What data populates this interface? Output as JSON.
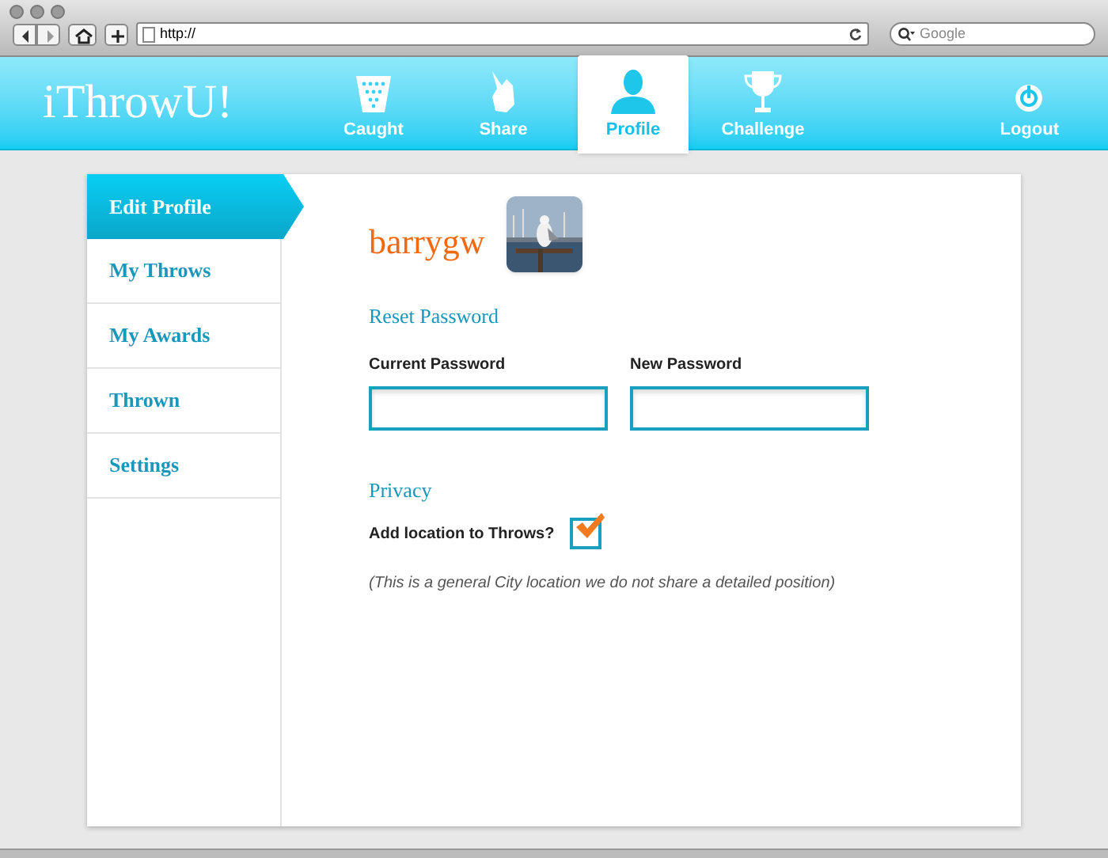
{
  "browser": {
    "address": "http://",
    "search_placeholder": "Google"
  },
  "app": {
    "logo": "iThrowU!"
  },
  "nav": [
    {
      "label": "Caught",
      "selected": false
    },
    {
      "label": "Share",
      "selected": false
    },
    {
      "label": "Profile",
      "selected": true
    },
    {
      "label": "Challenge",
      "selected": false
    }
  ],
  "logout": "Logout",
  "sidebar": {
    "items": [
      {
        "label": "Edit Profile",
        "selected": true
      },
      {
        "label": "My Throws",
        "selected": false
      },
      {
        "label": "My Awards",
        "selected": false
      },
      {
        "label": "Thrown",
        "selected": false
      },
      {
        "label": "Settings",
        "selected": false
      }
    ]
  },
  "profile": {
    "username": "barrygw"
  },
  "reset_password": {
    "heading": "Reset Password",
    "fields": [
      {
        "label": "Current Password"
      },
      {
        "label": "New Password"
      }
    ]
  },
  "privacy": {
    "heading": "Privacy",
    "option": {
      "label": "Add location to Throws?",
      "checked": true
    },
    "note": "(This is a general City location we do not share a detailed position)"
  }
}
